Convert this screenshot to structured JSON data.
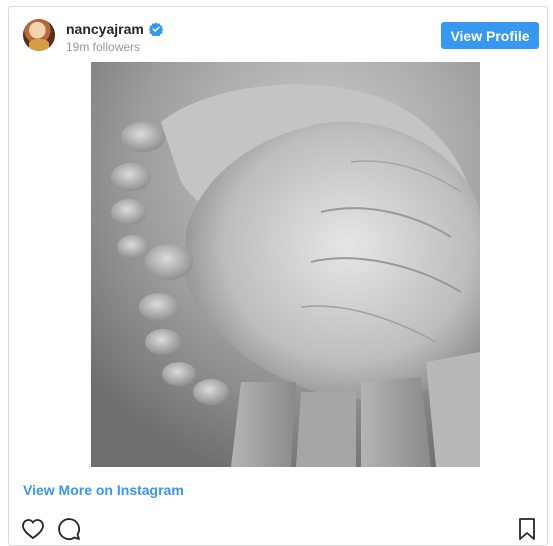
{
  "header": {
    "username": "nancyajram",
    "followers": "19m followers",
    "view_profile_label": "View Profile",
    "verified_icon": "verified-badge-icon",
    "avatar": "profile-avatar"
  },
  "post": {
    "image": "grayscale baby feet photo",
    "view_more_label": "View More on Instagram"
  },
  "actions": {
    "like_icon": "heart-icon",
    "comment_icon": "comment-icon",
    "save_icon": "bookmark-icon"
  },
  "colors": {
    "accent": "#3897f0",
    "border": "#dbdbdb",
    "text": "#262626",
    "muted": "#999999"
  }
}
